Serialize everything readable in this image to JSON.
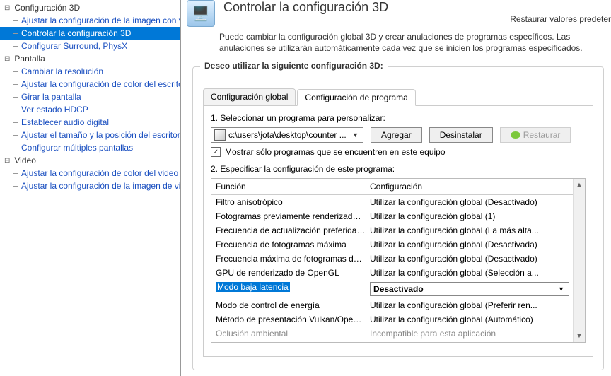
{
  "tree": {
    "groups": [
      {
        "label": "Configuración 3D",
        "items": [
          "Ajustar la configuración de la imagen con v",
          "Controlar la configuración 3D",
          "Configurar Surround, PhysX"
        ],
        "selected_index": 1
      },
      {
        "label": "Pantalla",
        "items": [
          "Cambiar la resolución",
          "Ajustar la configuración de color del escrito",
          "Girar la pantalla",
          "Ver estado HDCP",
          "Establecer audio digital",
          "Ajustar el tamaño y la posición del escritorio",
          "Configurar múltiples pantallas"
        ]
      },
      {
        "label": "Video",
        "items": [
          "Ajustar la configuración de color del video",
          "Ajustar la configuración de la imagen de vid"
        ]
      }
    ]
  },
  "header": {
    "title": "Controlar la configuración 3D",
    "restore_link": "Restaurar valores predeter"
  },
  "description": "Puede cambiar la configuración global 3D y crear anulaciones de programas específicos. Las anulaciones se utilizarán automáticamente cada vez que se inicien los programas especificados.",
  "group_title": "Deseo utilizar la siguiente configuración 3D:",
  "tabs": {
    "global": "Configuración global",
    "program": "Configuración de programa"
  },
  "step1_label": "1. Seleccionar un programa para personalizar:",
  "program_path": "c:\\users\\jota\\desktop\\counter ...",
  "btn_add": "Agregar",
  "btn_uninstall": "Desinstalar",
  "btn_restore": "Restaurar",
  "show_only_label": "Mostrar sólo programas que se encuentren en este equipo",
  "step2_label": "2. Especificar la configuración de este programa:",
  "col_function": "Función",
  "col_config": "Configuración",
  "rows": [
    {
      "fn": "Filtro anisotrópico",
      "cfg": "Utilizar la configuración global (Desactivado)"
    },
    {
      "fn": "Fotogramas previamente renderizados pa...",
      "cfg": "Utilizar la configuración global (1)"
    },
    {
      "fn": "Frecuencia de actualización preferida (Sa...",
      "cfg": "Utilizar la configuración global (La más alta..."
    },
    {
      "fn": "Frecuencia de fotogramas máxima",
      "cfg": "Utilizar la configuración global (Desactivada)"
    },
    {
      "fn": "Frecuencia máxima de fotogramas de la a...",
      "cfg": "Utilizar la configuración global (Desactivado)"
    },
    {
      "fn": "GPU de renderizado de OpenGL",
      "cfg": "Utilizar la configuración global (Selección a..."
    },
    {
      "fn": "Modo baja latencia",
      "cfg": "Desactivado",
      "selected": true
    },
    {
      "fn": "Modo de control de energía",
      "cfg": "Utilizar la configuración global (Preferir ren..."
    },
    {
      "fn": "Método de presentación Vulkan/OpenGL",
      "cfg": "Utilizar la configuración global (Automático)"
    },
    {
      "fn": "Oclusión ambiental",
      "cfg": "Incompatible para esta aplicación",
      "disabled": true
    }
  ]
}
